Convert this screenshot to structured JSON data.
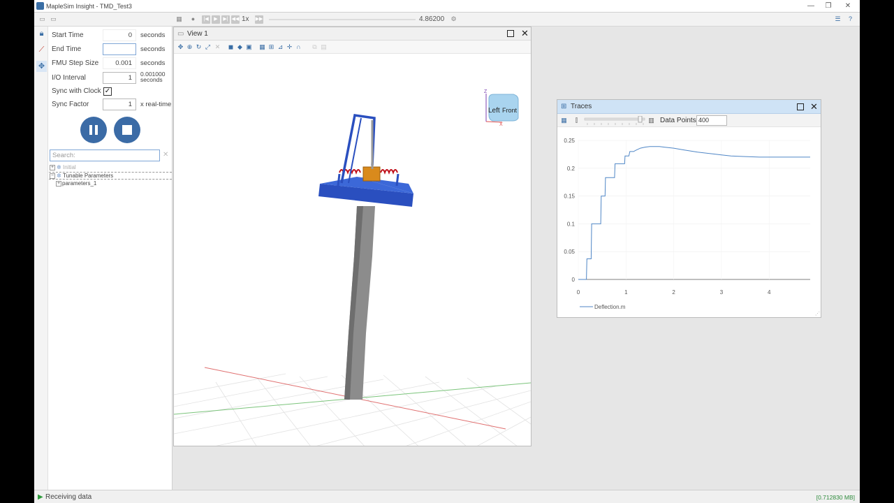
{
  "window": {
    "title": "MapleSim Insight - TMD_Test3"
  },
  "toolbar": {
    "speed": "1x",
    "time_value": "4.86200"
  },
  "settings": {
    "start_time": {
      "label": "Start Time",
      "value": "0",
      "unit": "seconds"
    },
    "end_time": {
      "label": "End Time",
      "value": "",
      "unit": "seconds"
    },
    "fmu_step": {
      "label": "FMU Step Size",
      "value": "0.001",
      "unit": "seconds"
    },
    "io_interval": {
      "label": "I/O Interval",
      "value": "1",
      "unit_line1": "0.001000",
      "unit_line2": "seconds"
    },
    "sync_clock": {
      "label": "Sync with Clock",
      "checked": "✓"
    },
    "sync_factor": {
      "label": "Sync Factor",
      "value": "1",
      "unit": "x real-time"
    }
  },
  "search": {
    "placeholder": "Search:"
  },
  "tree": {
    "initial": "Initial",
    "tunable": "Tunable Parameters",
    "params": "parameters_1"
  },
  "view1": {
    "title": "View 1",
    "cube_left": "Left",
    "cube_front": "Front",
    "axis_z": "Z",
    "axis_x": "X"
  },
  "traces": {
    "title": "Traces",
    "data_points_label": "Data Points",
    "data_points_value": "400",
    "chart_data": {
      "type": "line",
      "series": [
        {
          "name": "Deflection.m",
          "x": [
            0,
            0.17,
            0.18,
            0.27,
            0.28,
            0.37,
            0.38,
            0.47,
            0.48,
            0.56,
            0.57,
            0.67,
            0.68,
            0.76,
            0.77,
            0.86,
            0.87,
            0.97,
            0.98,
            1.06,
            1.08,
            1.16,
            1.2,
            1.3,
            1.4,
            1.5,
            1.6,
            1.7,
            1.8,
            2.0,
            2.2,
            2.5,
            2.8,
            3.0,
            3.2,
            3.5,
            3.8,
            4.0,
            4.3,
            4.6,
            4.86
          ],
          "y": [
            0,
            0,
            0.037,
            0.037,
            0.1,
            0.1,
            0.1,
            0.1,
            0.15,
            0.15,
            0.183,
            0.183,
            0.183,
            0.183,
            0.208,
            0.208,
            0.208,
            0.208,
            0.222,
            0.222,
            0.23,
            0.23,
            0.232,
            0.236,
            0.238,
            0.239,
            0.239,
            0.239,
            0.238,
            0.236,
            0.233,
            0.229,
            0.226,
            0.224,
            0.222,
            0.221,
            0.22,
            0.22,
            0.22,
            0.22,
            0.22
          ]
        }
      ],
      "xlim": [
        0,
        4.86
      ],
      "ylim": [
        0,
        0.25
      ],
      "xticks": [
        "0",
        "1",
        "2",
        "3",
        "4"
      ],
      "yticks": [
        "0",
        "0.05",
        "0.1",
        "0.15",
        "0.2",
        "0.25"
      ],
      "grid": true,
      "legend": "bottom-left",
      "color": "#4f86c6"
    }
  },
  "status": {
    "text": "Receiving data",
    "memory": "[0.712830 MB]"
  }
}
